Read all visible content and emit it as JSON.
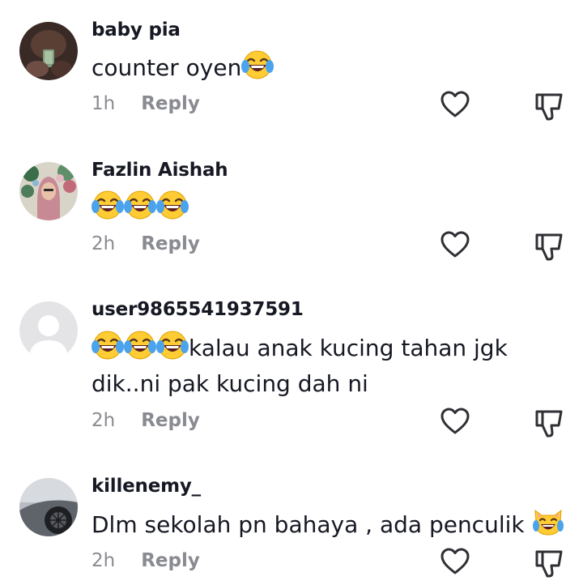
{
  "comments": [
    {
      "username": "baby pia",
      "text_before": "counter oyen",
      "text_after": "",
      "text_line2": "",
      "emojis": [
        "face-with-tears-of-joy"
      ],
      "time": "1h",
      "reply_label": "Reply"
    },
    {
      "username": "Fazlin Aishah",
      "text_before": "",
      "text_after": "",
      "text_line2": "",
      "emojis": [
        "face-with-tears-of-joy",
        "face-with-tears-of-joy",
        "face-with-tears-of-joy"
      ],
      "time": "2h",
      "reply_label": "Reply"
    },
    {
      "username": "user9865541937591",
      "text_before": "",
      "text_after": "kalau anak kucing tahan jgk",
      "text_line2": "dik..ni pak kucing dah ni",
      "emojis": [
        "face-with-tears-of-joy",
        "face-with-tears-of-joy",
        "face-with-tears-of-joy"
      ],
      "time": "2h",
      "reply_label": "Reply"
    },
    {
      "username": "killenemy_",
      "text_before": "Dlm sekolah pn bahaya , ada penculik ",
      "text_after": "",
      "text_line2": "",
      "emojis": [
        "cat-with-tears-of-joy"
      ],
      "time": "2h",
      "reply_label": "Reply"
    }
  ],
  "icons": {
    "like": "heart-outline-icon",
    "dislike": "thumbs-down-outline-icon"
  },
  "colors": {
    "text": "#161823",
    "secondary": "#8a8b91",
    "emoji_face": "#ffcc33"
  }
}
